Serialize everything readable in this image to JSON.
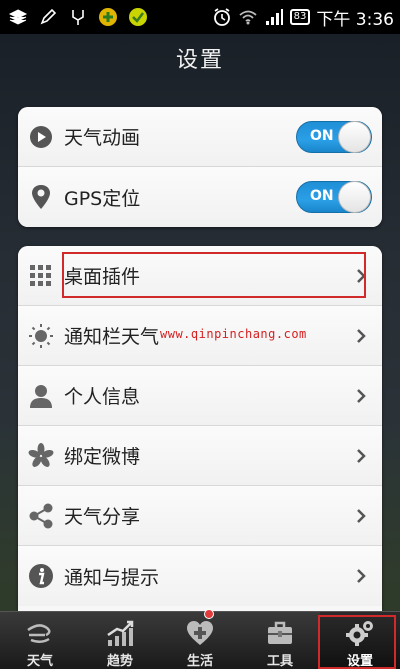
{
  "status_bar": {
    "time": "下午 3:36",
    "battery": "83",
    "icons": [
      "stack-icon",
      "pencil-icon",
      "tuning-fork-icon",
      "plus-app-icon",
      "check-app-icon",
      "alarm-icon",
      "wifi-icon",
      "signal-icon",
      "battery-icon"
    ]
  },
  "header": {
    "title": "设置"
  },
  "toggles": [
    {
      "label": "天气动画",
      "icon": "play-icon",
      "state": "ON"
    },
    {
      "label": "GPS定位",
      "icon": "location-pin-icon",
      "state": "ON"
    }
  ],
  "menu": [
    {
      "label": "桌面插件",
      "icon": "grid-icon"
    },
    {
      "label": "通知栏天气",
      "icon": "sun-icon"
    },
    {
      "label": "个人信息",
      "icon": "person-icon"
    },
    {
      "label": "绑定微博",
      "icon": "asterisk-icon"
    },
    {
      "label": "天气分享",
      "icon": "share-icon"
    },
    {
      "label": "通知与提示",
      "icon": "info-icon"
    }
  ],
  "watermark": "www.qinpinchang.com",
  "tabs": [
    {
      "label": "天气",
      "icon": "wind-icon",
      "active": false
    },
    {
      "label": "趋势",
      "icon": "trend-icon",
      "active": false
    },
    {
      "label": "生活",
      "icon": "heart-icon",
      "active": false,
      "badge": true
    },
    {
      "label": "工具",
      "icon": "toolbox-icon",
      "active": false
    },
    {
      "label": "设置",
      "icon": "gears-icon",
      "active": true
    }
  ],
  "colors": {
    "toggle_on": "#2b9fe6",
    "highlight": "#d12a2a",
    "badge": "#e23b3b"
  }
}
